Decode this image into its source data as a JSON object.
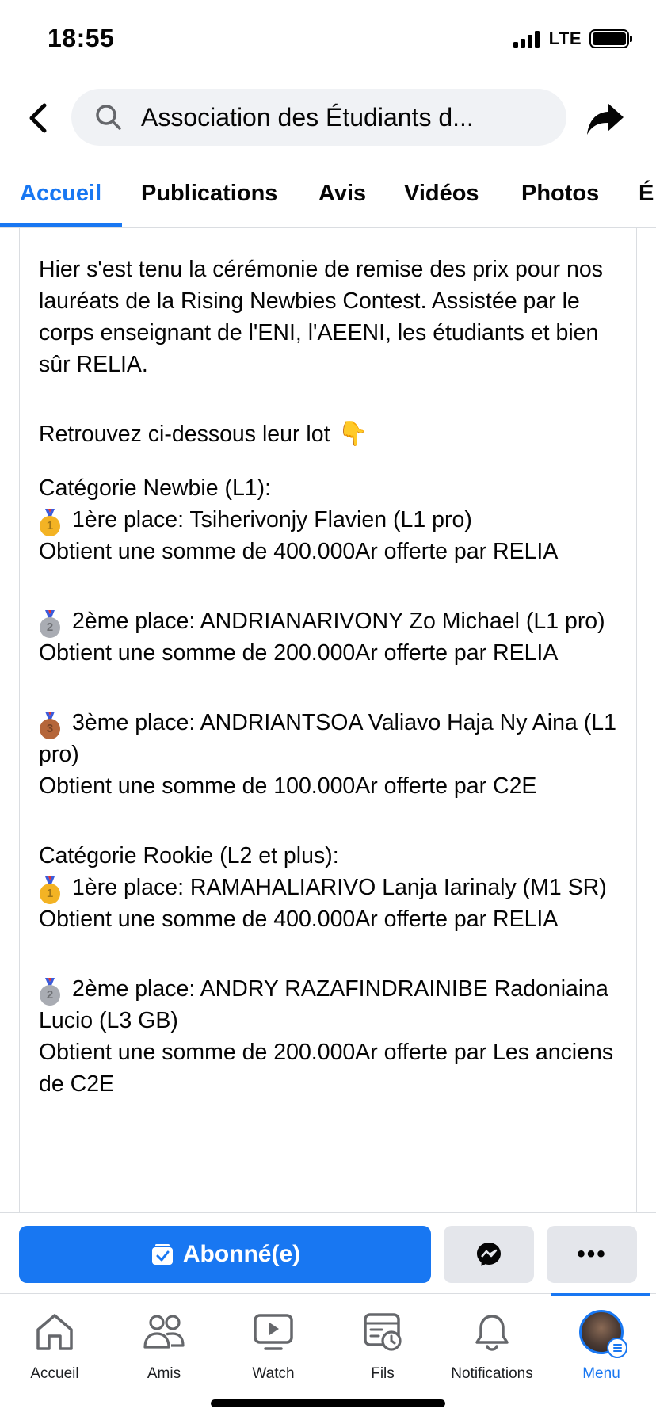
{
  "status_bar": {
    "time": "18:55",
    "network": "LTE"
  },
  "header": {
    "search_text": "Association des Étudiants d...",
    "icons": [
      "back-arrow-icon",
      "search-icon",
      "share-icon"
    ]
  },
  "tabs": [
    {
      "label": "Accueil",
      "active": true
    },
    {
      "label": "Publications",
      "active": false
    },
    {
      "label": "Avis",
      "active": false
    },
    {
      "label": "Vidéos",
      "active": false
    },
    {
      "label": "Photos",
      "active": false
    },
    {
      "label": "É",
      "active": false
    }
  ],
  "post": {
    "intro": "Hier s'est tenu la cérémonie de remise des prix pour nos lauréats de la Rising Newbies Contest. Assistée par le corps enseignant de l'ENI, l'AEENI, les étudiants et bien sûr RELIA.",
    "retrouvez": "Retrouvez ci-dessous leur lot",
    "cat1_title": "Catégorie Newbie (L1):",
    "cat1_p1_title": "1ère place: Tsiherivonjy Flavien (L1 pro)",
    "cat1_p1_prize": "Obtient une somme de 400.000Ar offerte par RELIA",
    "cat1_p2_title": "2ème place: ANDRIANARIVONY Zo Michael (L1 pro)",
    "cat1_p2_prize": "Obtient une somme de 200.000Ar offerte par RELIA",
    "cat1_p3_title": "3ème place: ANDRIANTSOA Valiavo Haja Ny Aina (L1 pro)",
    "cat1_p3_prize": "Obtient une somme de 100.000Ar offerte par C2E",
    "cat2_title": "Catégorie Rookie (L2 et plus):",
    "cat2_p1_title": "1ère place: RAMAHALIARIVO Lanja Iarinaly (M1 SR)",
    "cat2_p1_prize": "Obtient une somme de 400.000Ar offerte par RELIA",
    "cat2_p2_title": "2ème place: ANDRY RAZAFINDRAINIBE Radoniaina Lucio (L3 GB)",
    "cat2_p2_prize": "Obtient une somme de 200.000Ar offerte par Les anciens de C2E",
    "medal_icons": [
      "gold-medal-icon",
      "silver-medal-icon",
      "bronze-medal-icon"
    ],
    "hand_icon": "pointing-down-hand-icon"
  },
  "actions": {
    "follow_label": "Abonné(e)",
    "more_label": "•••",
    "icons": [
      "followed-check-icon",
      "messenger-icon",
      "more-icon"
    ]
  },
  "bottom_nav": [
    {
      "label": "Accueil",
      "icon": "home-icon",
      "active": false
    },
    {
      "label": "Amis",
      "icon": "friends-icon",
      "active": false
    },
    {
      "label": "Watch",
      "icon": "watch-icon",
      "active": false
    },
    {
      "label": "Fils",
      "icon": "feeds-icon",
      "active": false
    },
    {
      "label": "Notifications",
      "icon": "bell-icon",
      "active": false
    },
    {
      "label": "Menu",
      "icon": "avatar-menu-icon",
      "active": true
    }
  ],
  "colors": {
    "accent": "#1877f2",
    "text": "#050505",
    "secondary_bg": "#e4e6eb",
    "search_bg": "#f0f2f5"
  }
}
